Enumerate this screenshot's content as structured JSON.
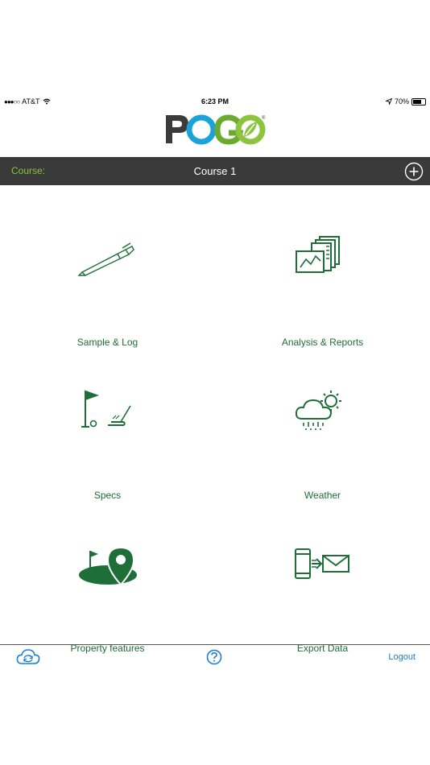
{
  "status_bar": {
    "signal_dots": "●●●○○",
    "carrier": "AT&T",
    "time": "6:23 PM",
    "battery_text": "70%",
    "battery_level": 0.7,
    "icons": [
      "wifi-icon",
      "location-arrow-icon",
      "battery-icon"
    ]
  },
  "logo": {
    "text": "POGO",
    "registered": "®"
  },
  "course_bar": {
    "label": "Course:",
    "name": "Course 1",
    "add_icon": "plus-circle-icon"
  },
  "tiles": [
    {
      "label": "Sample & Log",
      "icon": "pen-probe-icon"
    },
    {
      "label": "Analysis & Reports",
      "icon": "report-chart-icon"
    },
    {
      "label": "Specs",
      "icon": "golf-flag-putter-icon"
    },
    {
      "label": "Weather",
      "icon": "cloud-sun-rain-icon"
    },
    {
      "label": "Property features",
      "icon": "green-map-pin-icon"
    },
    {
      "label": "Export Data",
      "icon": "phone-to-mail-icon"
    }
  ],
  "footer": {
    "sync_icon": "cloud-sync-icon",
    "help_icon": "help-icon",
    "logout_label": "Logout"
  },
  "colors": {
    "brand_green": "#1d6e37",
    "accent_lime": "#8cc43e",
    "accent_blue": "#1aa3d9",
    "bar_dark": "#3a3a3a",
    "link_blue": "#1a7fd6"
  }
}
